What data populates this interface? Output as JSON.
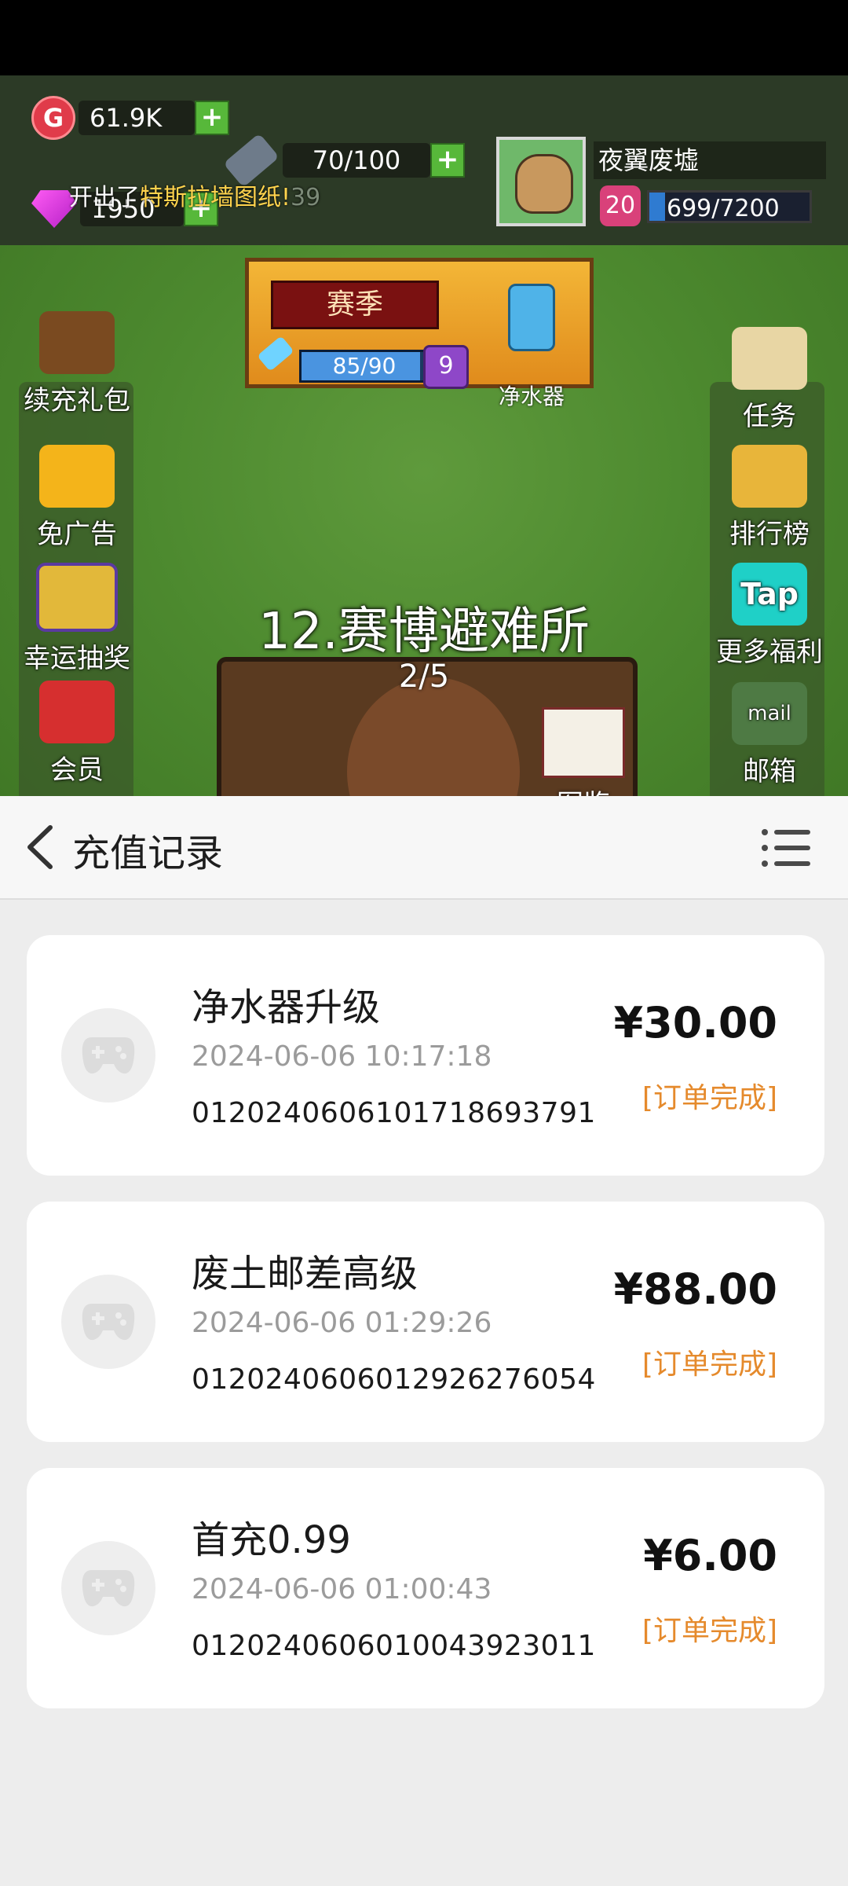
{
  "game": {
    "gold": "61.9K",
    "gems": "1950",
    "energy": "70/100",
    "toast_prefix": "开出了",
    "toast_item": "特斯拉墙图纸!",
    "toast_ghost": "39",
    "g_icon_letter": "G",
    "player_name": "夜翼废墟",
    "player_level": "20",
    "player_exp": "699/7200",
    "player_exp_fraction": 0.097,
    "season_label": "赛季",
    "season_progress": "85/90",
    "season_progress_fraction": 0.944,
    "season_level": "9",
    "season_reward": "净水器",
    "left_buttons": [
      "续充礼包",
      "免广告",
      "幸运抽奖",
      "会员"
    ],
    "right_buttons": [
      "任务",
      "排行榜",
      "更多福利",
      "邮箱"
    ],
    "tap_label": "Tap",
    "mail_label": "mail",
    "level_title": "12.赛博避难所",
    "level_progress": "2/5",
    "collection_label": "图鉴"
  },
  "sheet": {
    "title": "充值记录",
    "records": [
      {
        "name": "净水器升级",
        "time": "2024-06-06 10:17:18",
        "order": "0120240606101718693791",
        "amount": "¥30.00",
        "status": "[订单完成]"
      },
      {
        "name": "废土邮差高级",
        "time": "2024-06-06 01:29:26",
        "order": "0120240606012926276054",
        "amount": "¥88.00",
        "status": "[订单完成]"
      },
      {
        "name": "首充0.99",
        "time": "2024-06-06 01:00:43",
        "order": "0120240606010043923011",
        "amount": "¥6.00",
        "status": "[订单完成]"
      }
    ]
  },
  "colors": {
    "accent_status": "#e58a2c",
    "card_bg": "#ffffff",
    "sheet_bg": "#ededed"
  },
  "icons": {
    "back": "chevron-left-icon",
    "menu": "list-menu-icon",
    "record": "gamepad-icon"
  }
}
